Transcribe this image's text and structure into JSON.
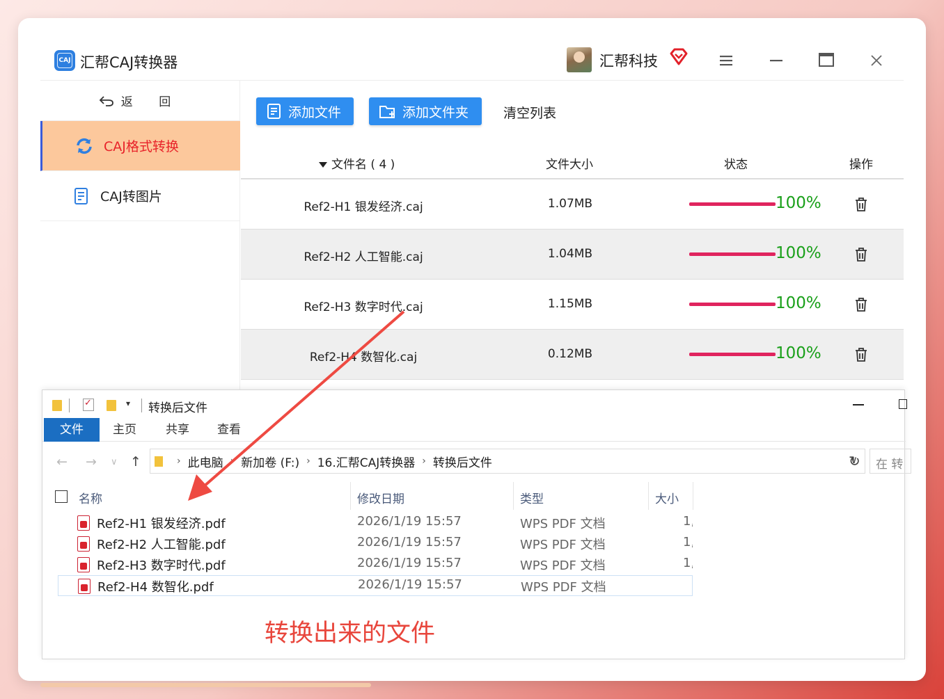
{
  "app": {
    "title": "汇帮CAJ转换器",
    "logo_text": "CAJ",
    "brand": "汇帮科技",
    "icons": [
      "vip-diamond-icon",
      "menu-icon",
      "minimize-icon",
      "maximize-icon",
      "close-icon"
    ]
  },
  "sidebar": {
    "back_label": "返 回",
    "items": [
      {
        "label": "CAJ格式转换",
        "icon": "refresh-icon",
        "active": true
      },
      {
        "label": "CAJ转图片",
        "icon": "document-icon",
        "active": false
      }
    ]
  },
  "toolbar": {
    "add_file": "添加文件",
    "add_folder": "添加文件夹",
    "clear_list": "清空列表"
  },
  "table": {
    "headers": {
      "name": "文件名 ( 4 )",
      "size": "文件大小",
      "status": "状态",
      "op": "操作"
    },
    "rows": [
      {
        "name": "Ref2-H1 银发经济.caj",
        "size": "1.07MB",
        "progress": "100%"
      },
      {
        "name": "Ref2-H2 人工智能.caj",
        "size": "1.04MB",
        "progress": "100%"
      },
      {
        "name": "Ref2-H3 数字时代.caj",
        "size": "1.15MB",
        "progress": "100%"
      },
      {
        "name": "Ref2-H4 数智化.caj",
        "size": "0.12MB",
        "progress": "100%"
      }
    ]
  },
  "explorer": {
    "title": "转换后文件",
    "ribbon": {
      "file": "文件",
      "home": "主页",
      "share": "共享",
      "view": "查看"
    },
    "breadcrumb": [
      "此电脑",
      "新加卷 (F:)",
      "16.汇帮CAJ转换器",
      "转换后文件"
    ],
    "search_placeholder": "在 转",
    "columns": {
      "name": "名称",
      "date": "修改日期",
      "type": "类型",
      "size": "大小"
    },
    "files": [
      {
        "name": "Ref2-H1 银发经济.pdf",
        "date": "2026/1/19 15:57",
        "type": "WPS PDF 文档",
        "size": "1,"
      },
      {
        "name": "Ref2-H2 人工智能.pdf",
        "date": "2026/1/19 15:57",
        "type": "WPS PDF 文档",
        "size": "1,"
      },
      {
        "name": "Ref2-H3 数字时代.pdf",
        "date": "2026/1/19 15:57",
        "type": "WPS PDF 文档",
        "size": "1,"
      },
      {
        "name": "Ref2-H4 数智化.pdf",
        "date": "2026/1/19 15:57",
        "type": "WPS PDF 文档",
        "size": ""
      }
    ]
  },
  "annotation": {
    "text": "转换出来的文件",
    "color": "#e8463c"
  },
  "colors": {
    "accent_blue": "#2f8ef0",
    "progress_bar": "#e0245e",
    "progress_text": "#1aa01a",
    "active_item_bg": "#fcc89c",
    "active_item_text": "#e8232a"
  }
}
